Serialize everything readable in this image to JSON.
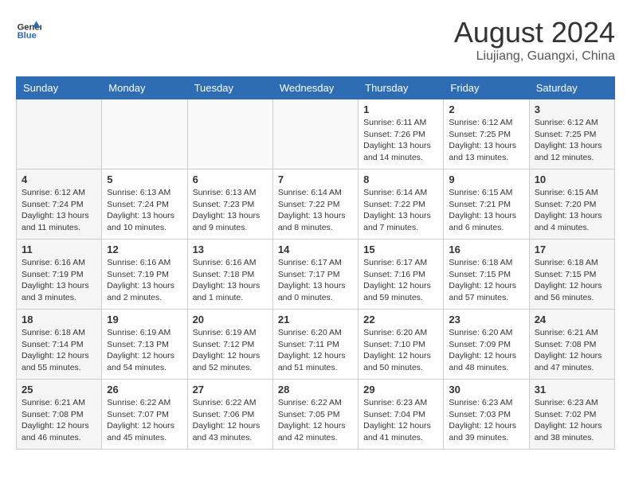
{
  "header": {
    "logo_line1": "General",
    "logo_line2": "Blue",
    "month_year": "August 2024",
    "location": "Liujiang, Guangxi, China"
  },
  "days_of_week": [
    "Sunday",
    "Monday",
    "Tuesday",
    "Wednesday",
    "Thursday",
    "Friday",
    "Saturday"
  ],
  "weeks": [
    [
      {
        "num": "",
        "text": ""
      },
      {
        "num": "",
        "text": ""
      },
      {
        "num": "",
        "text": ""
      },
      {
        "num": "",
        "text": ""
      },
      {
        "num": "1",
        "text": "Sunrise: 6:11 AM\nSunset: 7:26 PM\nDaylight: 13 hours\nand 14 minutes."
      },
      {
        "num": "2",
        "text": "Sunrise: 6:12 AM\nSunset: 7:25 PM\nDaylight: 13 hours\nand 13 minutes."
      },
      {
        "num": "3",
        "text": "Sunrise: 6:12 AM\nSunset: 7:25 PM\nDaylight: 13 hours\nand 12 minutes."
      }
    ],
    [
      {
        "num": "4",
        "text": "Sunrise: 6:12 AM\nSunset: 7:24 PM\nDaylight: 13 hours\nand 11 minutes."
      },
      {
        "num": "5",
        "text": "Sunrise: 6:13 AM\nSunset: 7:24 PM\nDaylight: 13 hours\nand 10 minutes."
      },
      {
        "num": "6",
        "text": "Sunrise: 6:13 AM\nSunset: 7:23 PM\nDaylight: 13 hours\nand 9 minutes."
      },
      {
        "num": "7",
        "text": "Sunrise: 6:14 AM\nSunset: 7:22 PM\nDaylight: 13 hours\nand 8 minutes."
      },
      {
        "num": "8",
        "text": "Sunrise: 6:14 AM\nSunset: 7:22 PM\nDaylight: 13 hours\nand 7 minutes."
      },
      {
        "num": "9",
        "text": "Sunrise: 6:15 AM\nSunset: 7:21 PM\nDaylight: 13 hours\nand 6 minutes."
      },
      {
        "num": "10",
        "text": "Sunrise: 6:15 AM\nSunset: 7:20 PM\nDaylight: 13 hours\nand 4 minutes."
      }
    ],
    [
      {
        "num": "11",
        "text": "Sunrise: 6:16 AM\nSunset: 7:19 PM\nDaylight: 13 hours\nand 3 minutes."
      },
      {
        "num": "12",
        "text": "Sunrise: 6:16 AM\nSunset: 7:19 PM\nDaylight: 13 hours\nand 2 minutes."
      },
      {
        "num": "13",
        "text": "Sunrise: 6:16 AM\nSunset: 7:18 PM\nDaylight: 13 hours\nand 1 minute."
      },
      {
        "num": "14",
        "text": "Sunrise: 6:17 AM\nSunset: 7:17 PM\nDaylight: 13 hours\nand 0 minutes."
      },
      {
        "num": "15",
        "text": "Sunrise: 6:17 AM\nSunset: 7:16 PM\nDaylight: 12 hours\nand 59 minutes."
      },
      {
        "num": "16",
        "text": "Sunrise: 6:18 AM\nSunset: 7:15 PM\nDaylight: 12 hours\nand 57 minutes."
      },
      {
        "num": "17",
        "text": "Sunrise: 6:18 AM\nSunset: 7:15 PM\nDaylight: 12 hours\nand 56 minutes."
      }
    ],
    [
      {
        "num": "18",
        "text": "Sunrise: 6:18 AM\nSunset: 7:14 PM\nDaylight: 12 hours\nand 55 minutes."
      },
      {
        "num": "19",
        "text": "Sunrise: 6:19 AM\nSunset: 7:13 PM\nDaylight: 12 hours\nand 54 minutes."
      },
      {
        "num": "20",
        "text": "Sunrise: 6:19 AM\nSunset: 7:12 PM\nDaylight: 12 hours\nand 52 minutes."
      },
      {
        "num": "21",
        "text": "Sunrise: 6:20 AM\nSunset: 7:11 PM\nDaylight: 12 hours\nand 51 minutes."
      },
      {
        "num": "22",
        "text": "Sunrise: 6:20 AM\nSunset: 7:10 PM\nDaylight: 12 hours\nand 50 minutes."
      },
      {
        "num": "23",
        "text": "Sunrise: 6:20 AM\nSunset: 7:09 PM\nDaylight: 12 hours\nand 48 minutes."
      },
      {
        "num": "24",
        "text": "Sunrise: 6:21 AM\nSunset: 7:08 PM\nDaylight: 12 hours\nand 47 minutes."
      }
    ],
    [
      {
        "num": "25",
        "text": "Sunrise: 6:21 AM\nSunset: 7:08 PM\nDaylight: 12 hours\nand 46 minutes."
      },
      {
        "num": "26",
        "text": "Sunrise: 6:22 AM\nSunset: 7:07 PM\nDaylight: 12 hours\nand 45 minutes."
      },
      {
        "num": "27",
        "text": "Sunrise: 6:22 AM\nSunset: 7:06 PM\nDaylight: 12 hours\nand 43 minutes."
      },
      {
        "num": "28",
        "text": "Sunrise: 6:22 AM\nSunset: 7:05 PM\nDaylight: 12 hours\nand 42 minutes."
      },
      {
        "num": "29",
        "text": "Sunrise: 6:23 AM\nSunset: 7:04 PM\nDaylight: 12 hours\nand 41 minutes."
      },
      {
        "num": "30",
        "text": "Sunrise: 6:23 AM\nSunset: 7:03 PM\nDaylight: 12 hours\nand 39 minutes."
      },
      {
        "num": "31",
        "text": "Sunrise: 6:23 AM\nSunset: 7:02 PM\nDaylight: 12 hours\nand 38 minutes."
      }
    ]
  ]
}
